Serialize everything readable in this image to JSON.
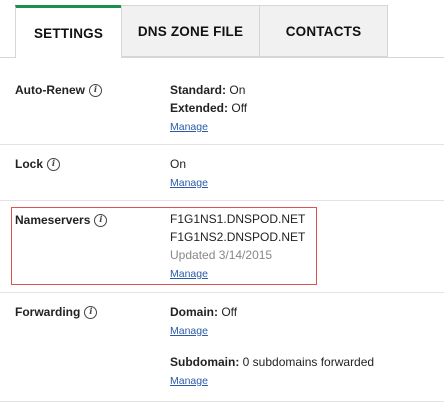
{
  "tabs": [
    {
      "label": "SETTINGS",
      "active": true
    },
    {
      "label": "DNS ZONE FILE",
      "active": false
    },
    {
      "label": "CONTACTS",
      "active": false
    }
  ],
  "rows": {
    "autorenew": {
      "label": "Auto-Renew",
      "standard_label": "Standard:",
      "standard_value": "On",
      "extended_label": "Extended:",
      "extended_value": "Off",
      "manage": "Manage"
    },
    "lock": {
      "label": "Lock",
      "value": "On",
      "manage": "Manage"
    },
    "nameservers": {
      "label": "Nameservers",
      "ns1": "F1G1NS1.DNSPOD.NET",
      "ns2": "F1G1NS2.DNSPOD.NET",
      "updated": "Updated 3/14/2015",
      "manage": "Manage"
    },
    "forwarding": {
      "label": "Forwarding",
      "domain_label": "Domain:",
      "domain_value": "Off",
      "manage_domain": "Manage",
      "subdomain_label": "Subdomain:",
      "subdomain_value": "0 subdomains forwarded",
      "manage_subdomain": "Manage"
    }
  },
  "info_icon_glyph": "i",
  "colors": {
    "accent": "#1e8e4e",
    "link": "#2b5aa8",
    "highlight": "#d9534f"
  }
}
